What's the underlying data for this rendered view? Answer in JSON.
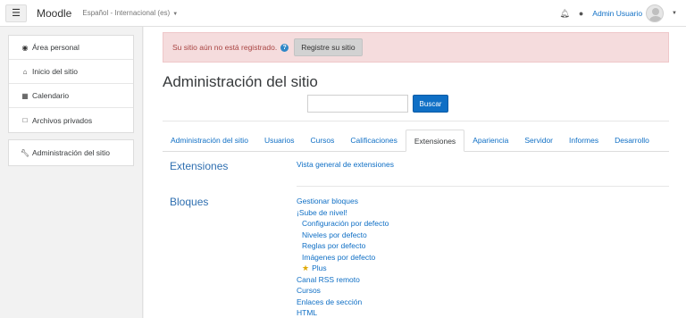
{
  "navbar": {
    "menu_icon": "hamburger-icon",
    "brand": "Moodle",
    "language": "Español - Internacional (es)",
    "notifications_icon": "bell-icon",
    "messages_icon": "chat-icon",
    "user_name": "Admin Usuario"
  },
  "drawer": {
    "items": [
      {
        "label": "Área personal",
        "icon": "dashboard-icon"
      },
      {
        "label": "Inicio del sitio",
        "icon": "home-icon"
      },
      {
        "label": "Calendario",
        "icon": "calendar-icon"
      },
      {
        "label": "Archivos privados",
        "icon": "file-icon"
      }
    ],
    "admin_item": {
      "label": "Administración del sitio",
      "icon": "wrench-icon"
    }
  },
  "alert": {
    "text": "Su sitio aún no está registrado.",
    "button_label": "Registre su sitio"
  },
  "main": {
    "title": "Administración del sitio",
    "search_value": "",
    "search_button": "Buscar"
  },
  "tabs": [
    {
      "label": "Administración del sitio",
      "active": false
    },
    {
      "label": "Usuarios",
      "active": false
    },
    {
      "label": "Cursos",
      "active": false
    },
    {
      "label": "Calificaciones",
      "active": false
    },
    {
      "label": "Extensiones",
      "active": true
    },
    {
      "label": "Apariencia",
      "active": false
    },
    {
      "label": "Servidor",
      "active": false
    },
    {
      "label": "Informes",
      "active": false
    },
    {
      "label": "Desarrollo",
      "active": false
    }
  ],
  "sections": {
    "extensiones": {
      "title": "Extensiones",
      "links": [
        "Vista general de extensiones"
      ]
    },
    "bloques": {
      "title": "Bloques",
      "links": [
        "Gestionar bloques",
        "¡Sube de nivel!",
        "Configuración por defecto",
        "Niveles por defecto",
        "Reglas por defecto",
        "Imágenes por defecto",
        "Plus",
        "Canal RSS remoto",
        "Cursos",
        "Enlaces de sección",
        "HTML"
      ]
    }
  },
  "colors": {
    "accent": "#0f6fc5",
    "alert_bg": "#f5dcdd",
    "alert_text": "#a94442"
  }
}
